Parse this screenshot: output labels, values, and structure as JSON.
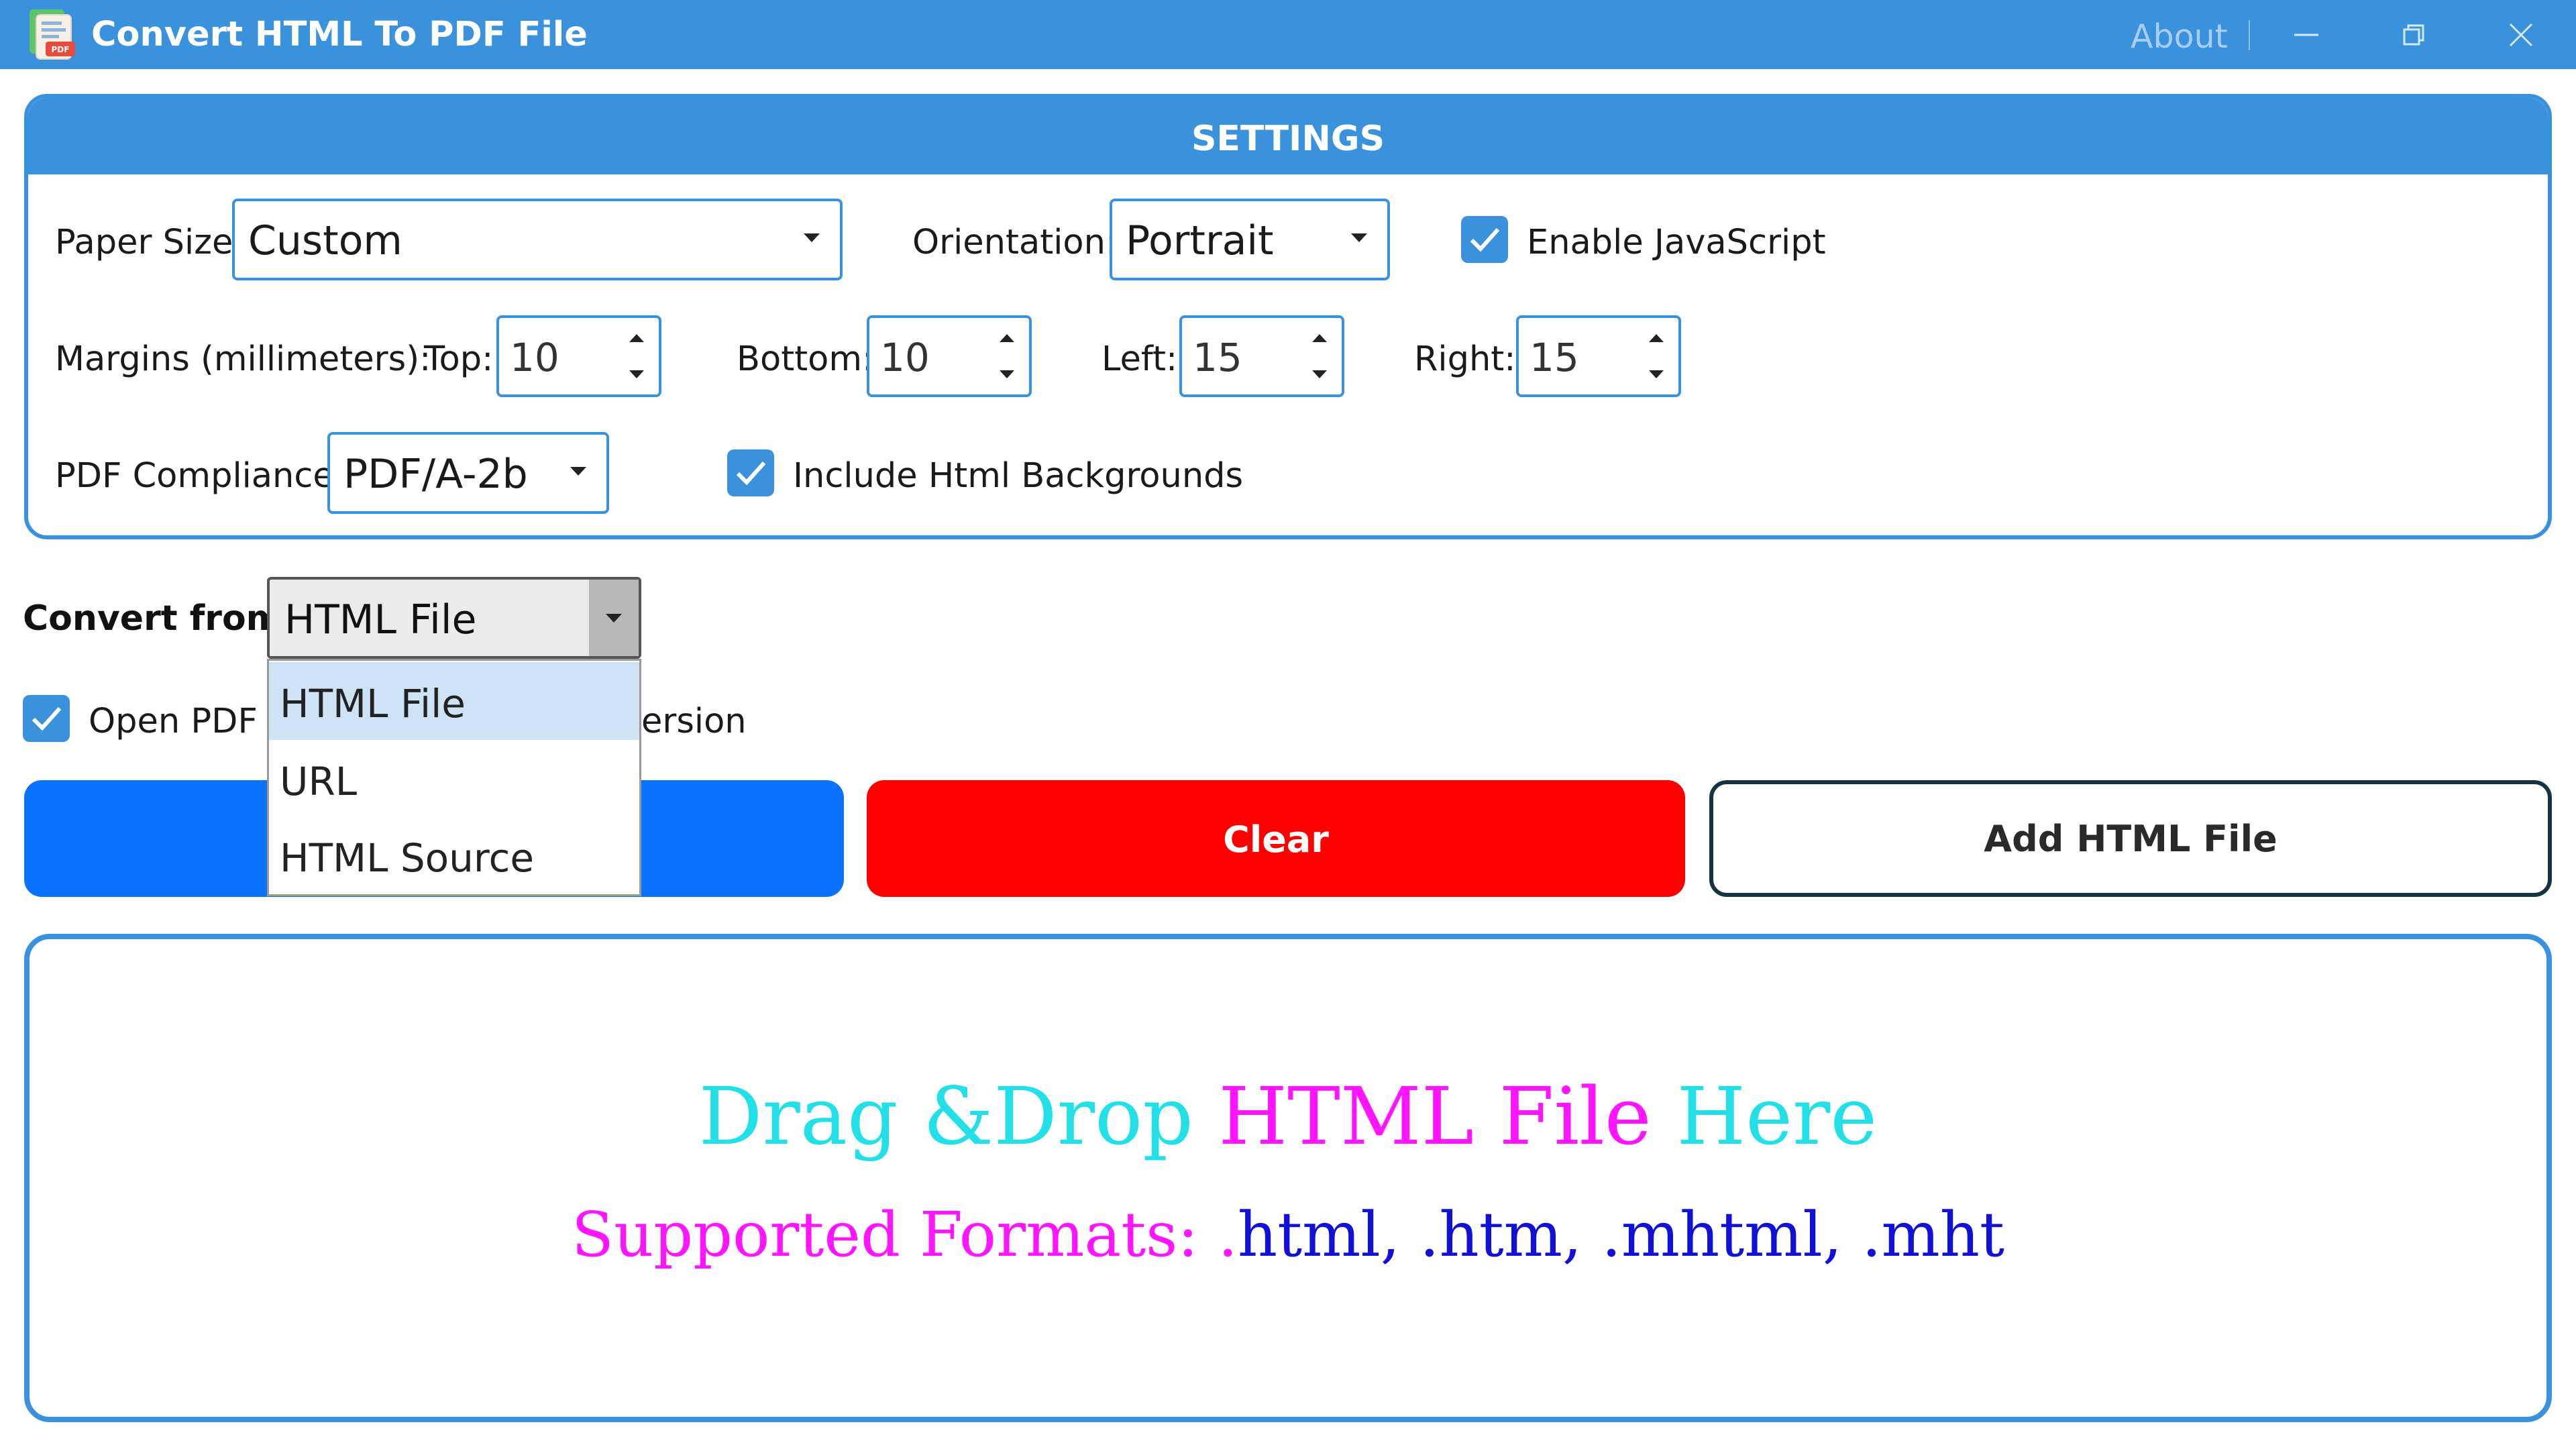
{
  "window": {
    "title": "Convert HTML To PDF File",
    "about_label": "About",
    "icon": "pdf-file-icon",
    "controls": [
      "minimize-icon",
      "restore-icon",
      "close-icon"
    ],
    "accent_color": "#3a92dc"
  },
  "settings": {
    "header": "SETTINGS",
    "paper_size": {
      "label": "Paper Size:",
      "value": "Custom"
    },
    "orientation": {
      "label": "Orientation:",
      "value": "Portrait"
    },
    "enable_javascript": {
      "label": "Enable JavaScript",
      "checked": true
    },
    "margins": {
      "label": "Margins (millimeters):",
      "top": {
        "label": "Top:",
        "value": "10"
      },
      "bottom": {
        "label": "Bottom:",
        "value": "10"
      },
      "left": {
        "label": "Left:",
        "value": "15"
      },
      "right": {
        "label": "Right:",
        "value": "15"
      }
    },
    "pdf_compliance": {
      "label": "PDF Compliance:",
      "value": "PDF/A-2b"
    },
    "include_backgrounds": {
      "label": "Include Html Backgrounds",
      "checked": true
    }
  },
  "convert_from": {
    "label": "Convert from:",
    "value": "HTML File",
    "options": [
      "HTML File",
      "URL",
      "HTML Source"
    ],
    "selected_index": 0
  },
  "open_pdf": {
    "label_visible_start": "Open PDF f",
    "label_visible_end": "ersion",
    "checked": true
  },
  "buttons": {
    "convert_color": "#0a72ff",
    "clear_label": "Clear",
    "clear_color": "#ff0000",
    "add_label": "Add HTML File"
  },
  "dropzone": {
    "line1": {
      "part1": "Drag &Drop ",
      "part2": "HTML File",
      "part3": " Here"
    },
    "line2": {
      "part1": "Supported Formats: .",
      "part2": "html, .htm, .mhtml, .mht"
    },
    "colors": {
      "cyan": "#22e0e8",
      "magenta": "#ff14ff",
      "blue": "#1010d8"
    }
  }
}
